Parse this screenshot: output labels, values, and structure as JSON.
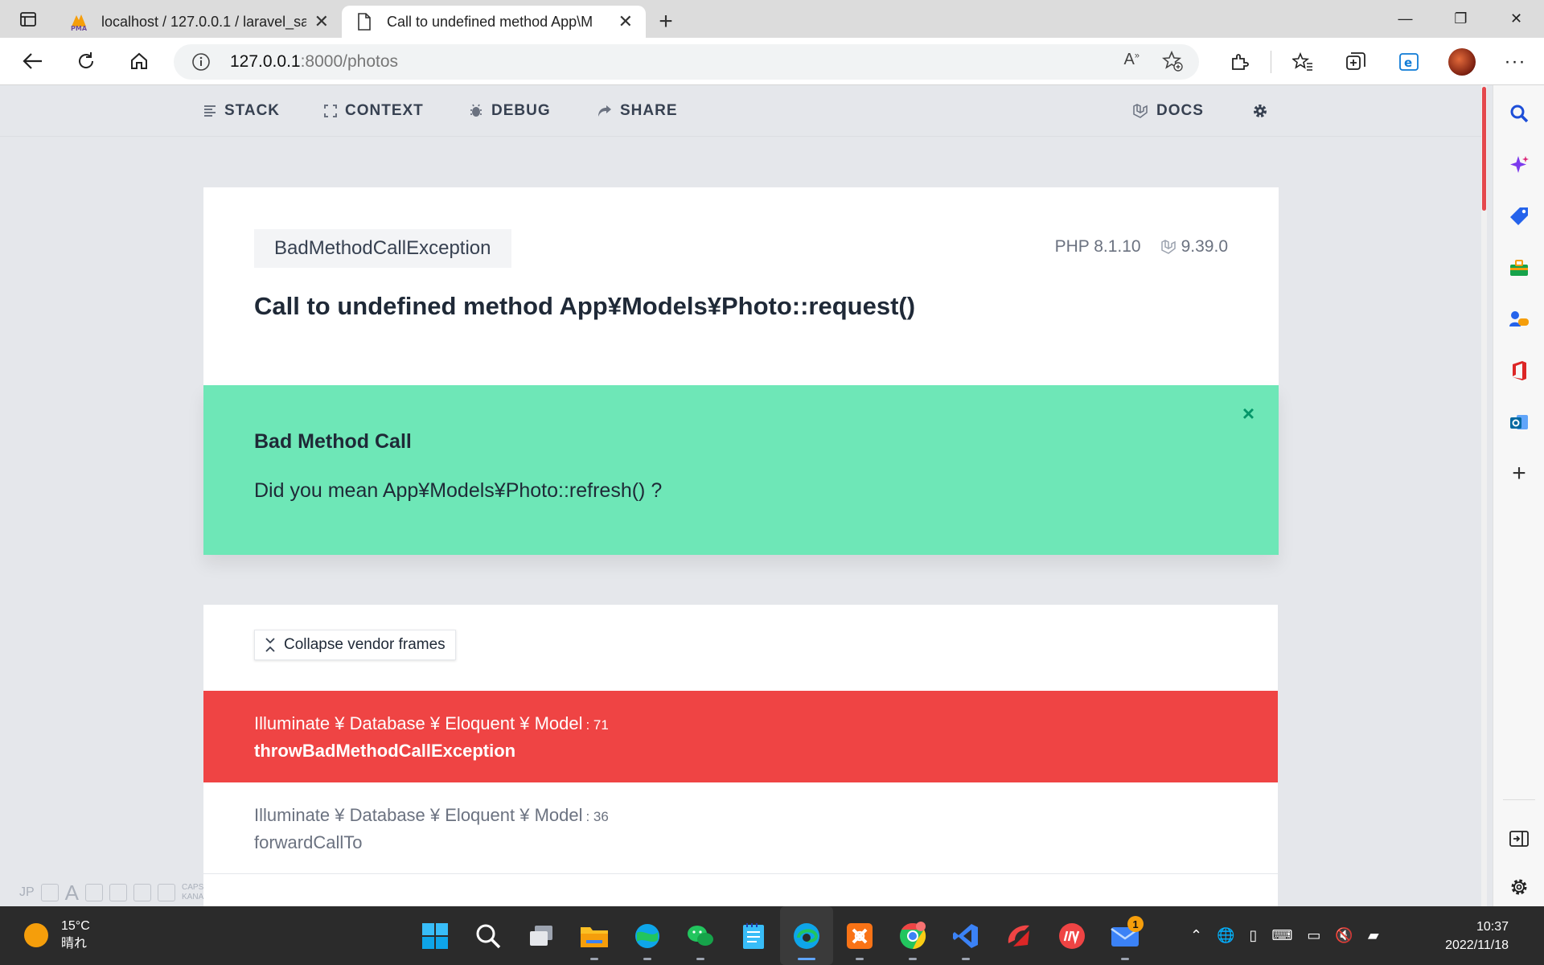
{
  "browser": {
    "tabs": [
      {
        "title": "localhost / 127.0.0.1 / laravel_san",
        "favicon": "phpmyadmin-icon",
        "favicon_text": "PMA"
      },
      {
        "title": "Call to undefined method App\\M",
        "favicon": "document-icon"
      }
    ],
    "url_host": "127.0.0.1",
    "url_rest": ":8000/photos"
  },
  "ignition": {
    "nav": {
      "stack": "STACK",
      "context": "CONTEXT",
      "debug": "DEBUG",
      "share": "SHARE",
      "docs": "DOCS"
    },
    "exception_class": "BadMethodCallException",
    "php_version": "PHP 8.1.10",
    "laravel_version": "9.39.0",
    "message": "Call to undefined method App¥Models¥Photo::request()",
    "solution": {
      "title": "Bad Method Call",
      "description": "Did you mean App¥Models¥Photo::refresh() ?",
      "close_symbol": "×"
    },
    "collapse_label": "Collapse vendor frames",
    "frames": [
      {
        "class": "Illuminate ¥ Database ¥ Eloquent ¥ Model",
        "line": ": 71",
        "function": "throwBadMethodCallException",
        "selected": true
      },
      {
        "class": "Illuminate ¥ Database ¥ Eloquent ¥ Model",
        "line": ": 36",
        "function": "forwardCallTo",
        "selected": false
      }
    ]
  },
  "ime": {
    "lang": "JP",
    "caps": "CAPS",
    "kana": "KANA"
  },
  "taskbar": {
    "temperature": "15°C",
    "condition": "晴れ",
    "time": "10:37",
    "date": "2022/11/18",
    "mail_badge": "1",
    "apps": [
      "windows-start-icon",
      "search-icon",
      "task-view-icon",
      "file-explorer-icon",
      "globe-icon",
      "wechat-icon",
      "notepad-icon",
      "edge-icon",
      "xampp-icon",
      "chrome-icon",
      "vscode-icon",
      "app-red-icon",
      "app-red-circle-icon",
      "mail-icon"
    ]
  },
  "colors": {
    "accent_red": "#ef4444",
    "solution_green": "#6ee7b7",
    "page_bg": "#e5e7eb"
  }
}
